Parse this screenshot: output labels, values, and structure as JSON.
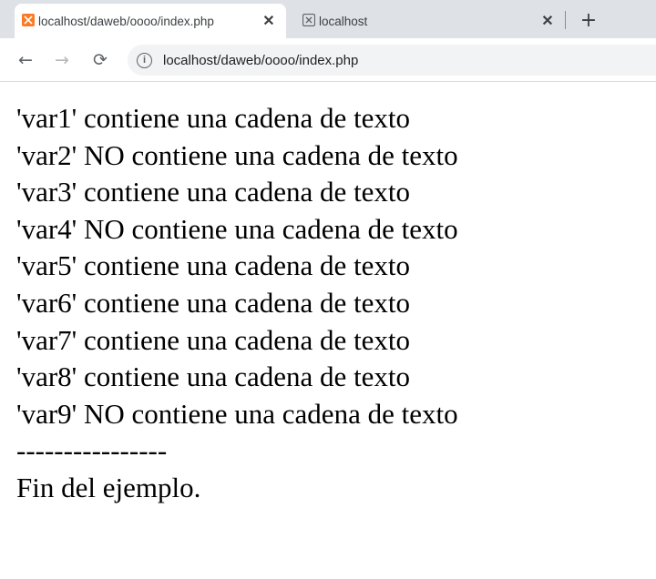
{
  "tabs": [
    {
      "title": "localhost/daweb/oooo/index.php",
      "icon": "xampp-favicon-icon",
      "active": true
    },
    {
      "title": "localhost",
      "icon": "xampp-favicon-icon",
      "active": false
    }
  ],
  "toolbar": {
    "back": "←",
    "forward": "→",
    "reload": "⟳",
    "info_icon": "i",
    "url": "localhost/daweb/oooo/index.php"
  },
  "tabbar": {
    "close": "✕",
    "new_tab": "+"
  },
  "colors": {
    "favicon": "#fb7a24",
    "tabbar_bg": "#dee1e6",
    "omnibox_bg": "#f1f3f4"
  },
  "content": {
    "lines": [
      "'var1' contiene una cadena de texto",
      "'var2' NO contiene una cadena de texto",
      "'var3' contiene una cadena de texto",
      "'var4' NO contiene una cadena de texto",
      "'var5' contiene una cadena de texto",
      "'var6' contiene una cadena de texto",
      "'var7' contiene una cadena de texto",
      "'var8' contiene una cadena de texto",
      "'var9' NO contiene una cadena de texto"
    ],
    "separator": "----------------",
    "footer": "Fin del ejemplo."
  }
}
